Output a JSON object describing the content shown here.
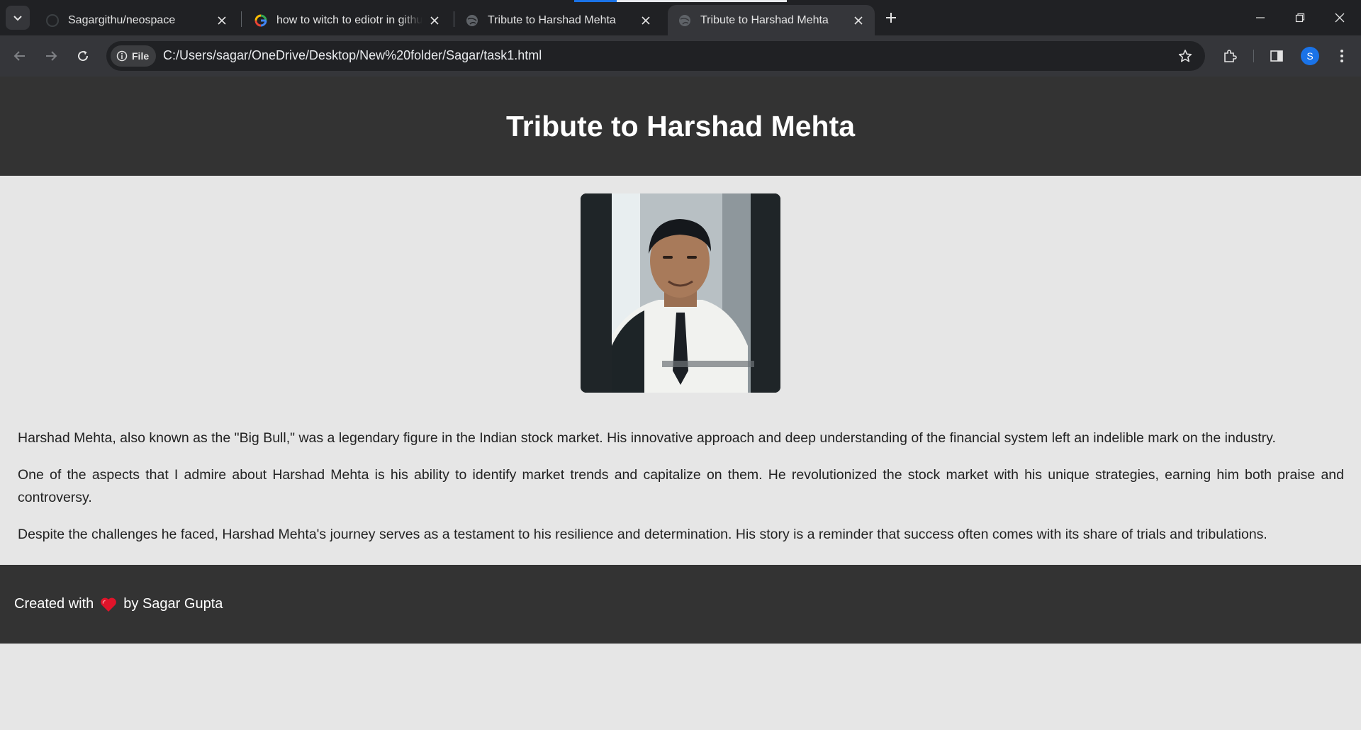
{
  "browser": {
    "tabs": [
      {
        "title": "Sagargithu/neospace",
        "favicon": "github-icon",
        "active": false
      },
      {
        "title": "how to witch to ediotr in github",
        "favicon": "google-icon",
        "active": false
      },
      {
        "title": "Tribute to Harshad Mehta",
        "favicon": "globe-icon",
        "active": false
      },
      {
        "title": "Tribute to Harshad Mehta",
        "favicon": "globe-icon",
        "active": true
      }
    ],
    "address": {
      "scheme_label": "File",
      "url": "C:/Users/sagar/OneDrive/Desktop/New%20folder/Sagar/task1.html"
    },
    "profile_initial": "S"
  },
  "page": {
    "header_title": "Tribute to Harshad Mehta",
    "image": {
      "alt": "Harshad Mehta",
      "watermark": "©BCCL 2005. ALL RIGHTS RESERVED"
    },
    "paragraphs": [
      "Harshad Mehta, also known as the \"Big Bull,\" was a legendary figure in the Indian stock market. His innovative approach and deep understanding of the financial system left an indelible mark on the industry.",
      "One of the aspects that I admire about Harshad Mehta is his ability to identify market trends and capitalize on them. He revolutionized the stock market with his unique strategies, earning him both praise and controversy.",
      "Despite the challenges he faced, Harshad Mehta's journey serves as a testament to his resilience and determination. His story is a reminder that success often comes with its share of trials and tribulations."
    ],
    "footer": {
      "prefix": "Created with",
      "suffix": "by Sagar Gupta",
      "heart_color": "#e0142a"
    }
  },
  "colors": {
    "header_bg": "#333333",
    "body_bg": "#e6e6e6",
    "text": "#222222"
  }
}
